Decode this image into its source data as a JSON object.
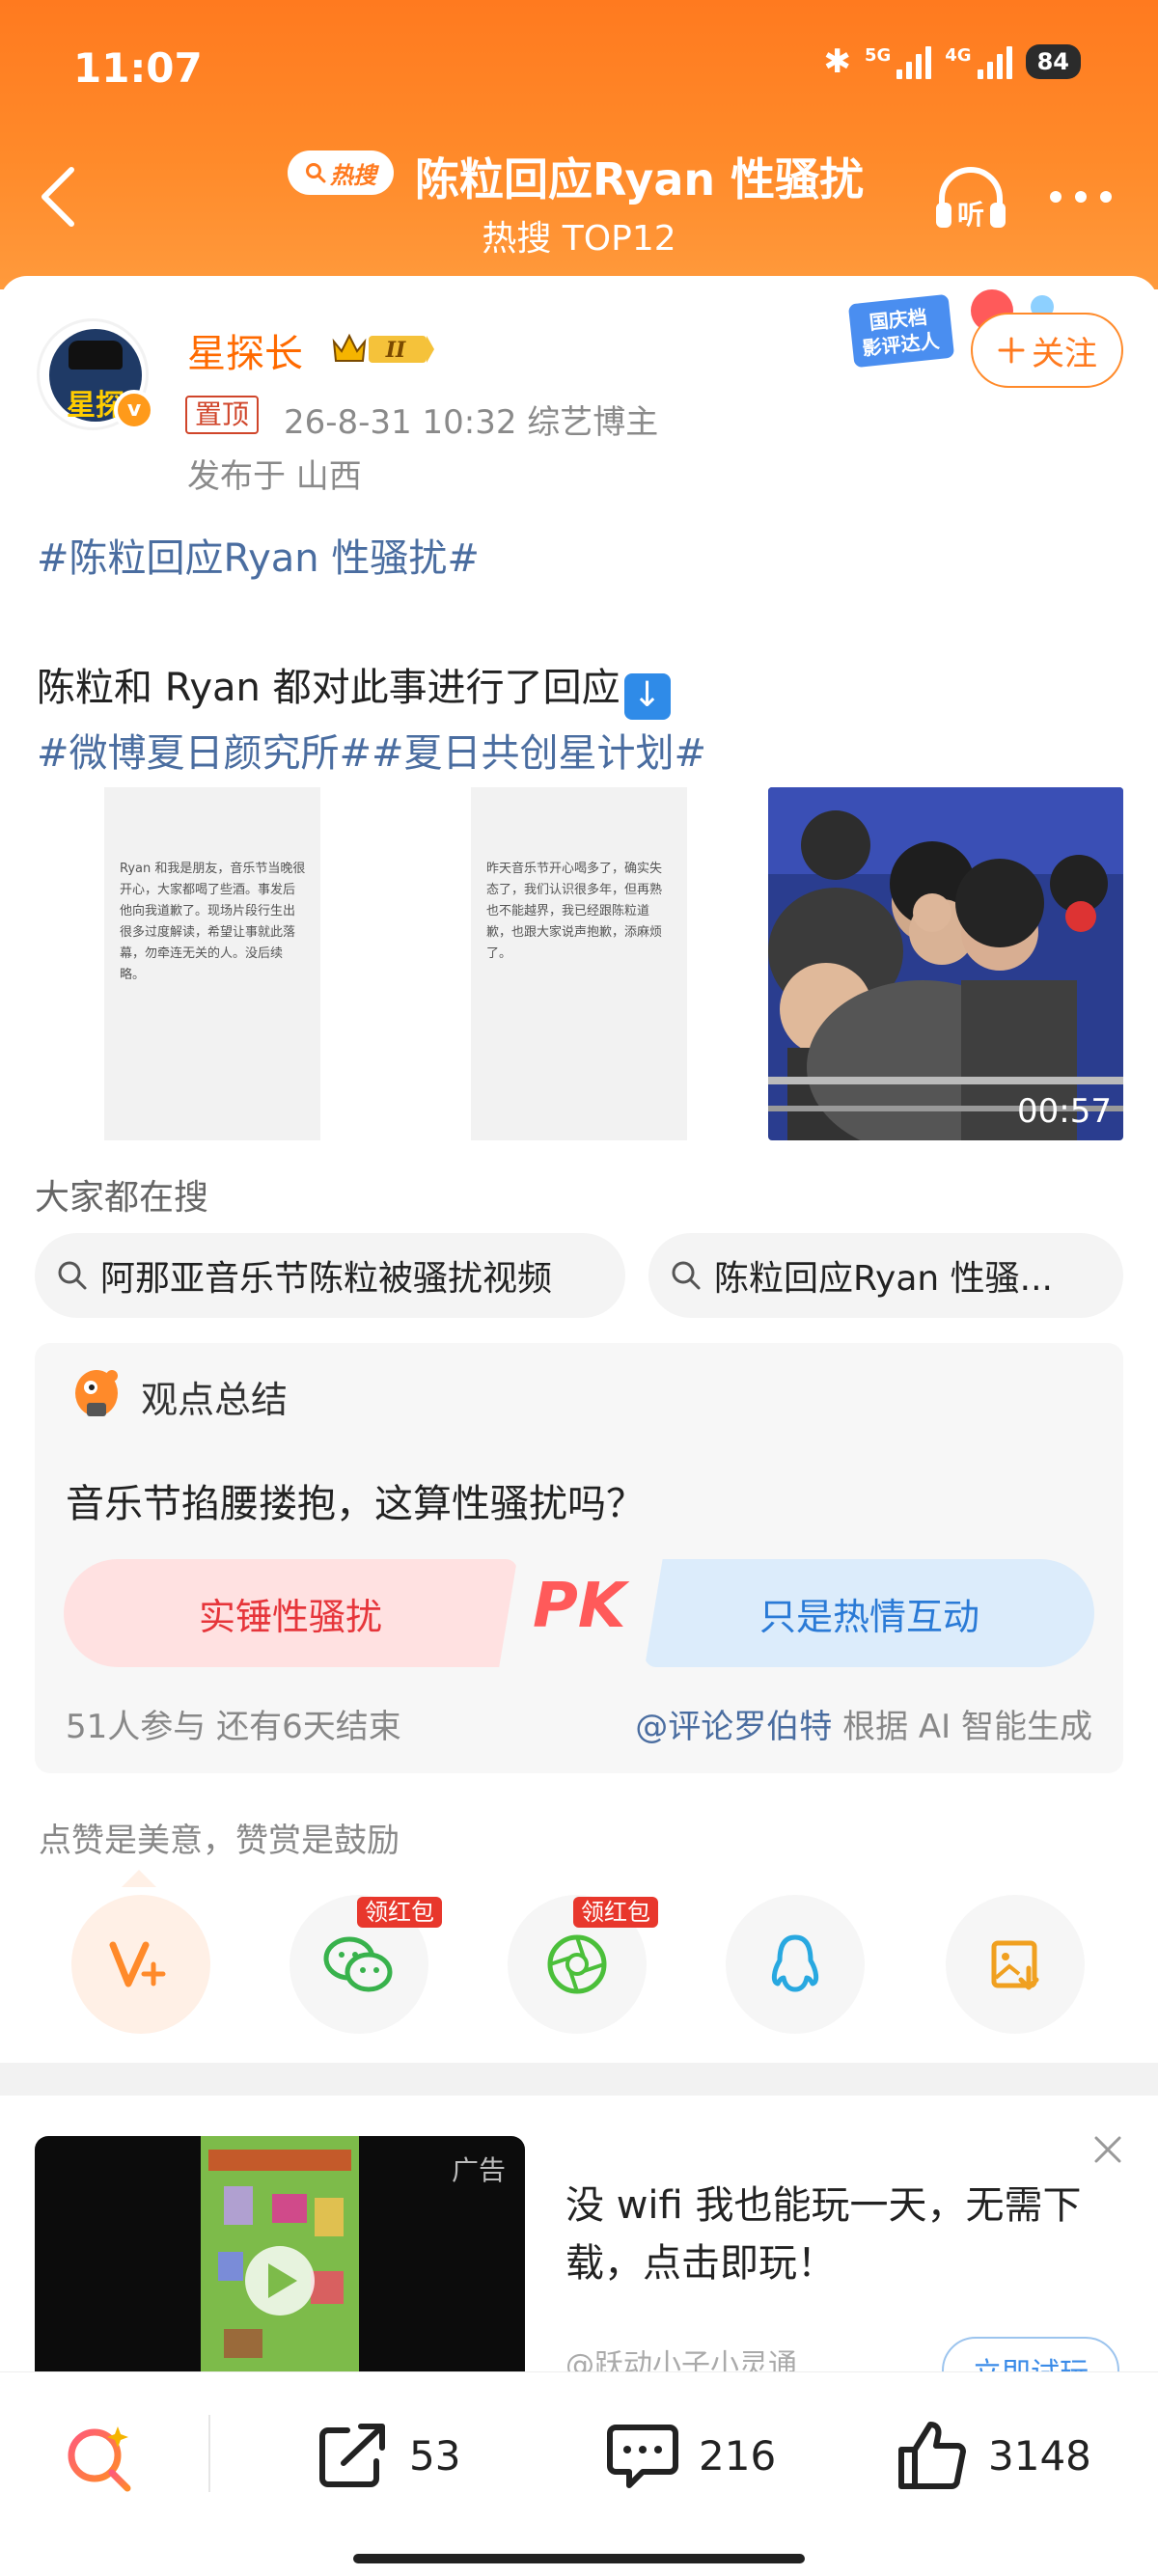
{
  "status_bar": {
    "time": "11:07",
    "network_1": "5G",
    "network_2": "4G",
    "battery": "84"
  },
  "header": {
    "hot_badge": "热搜",
    "title": "陈粒回应Ryan 性骚扰",
    "subtitle": "热搜 TOP12",
    "listen_label": "听"
  },
  "post": {
    "author": {
      "name": "星探长",
      "level": "II",
      "avatar_text": "星探",
      "verified_mark": "v"
    },
    "pinned_label": "置顶",
    "meta": "26-8-31 10:32   综艺博主",
    "location": "发布于 山西",
    "follow_label": "关注",
    "promo_badge": "国庆档影评达人",
    "topic_tag": "#陈粒回应Ryan 性骚扰#",
    "text_line1": "陈粒和 Ryan 都对此事进行了回应",
    "text_line2": "#微博夏日颜究所##夏日共创星计划#",
    "image1_text": "Ryan 和我是朋友，音乐节当晚很开心，大家都喝了些酒。事发后他向我道歉了。现场片段行生出很多过度解读，希望让事就此落幕，勿牵连无关的人。没后续略。",
    "image2_text": "昨天音乐节开心喝多了，确实失态了，我们认识很多年，但再熟也不能越界，我已经跟陈粒道歉，也跟大家说声抱歉，添麻烦了。",
    "video_duration": "00:57"
  },
  "related_search": {
    "title": "大家都在搜",
    "chips": [
      "阿那亚音乐节陈粒被骚扰视频",
      "陈粒回应Ryan 性骚..."
    ]
  },
  "summary": {
    "title": "观点总结",
    "question": "音乐节掐腰搂抱，这算性骚扰吗？",
    "option_left": "实锤性骚扰",
    "option_right": "只是热情互动",
    "pk_label": "PK",
    "participants": "51人参与   还有6天结束",
    "source_at": "@评论罗伯特",
    "source_suffix": " 根据 AI 智能生成"
  },
  "reward": {
    "text": "点赞是美意，赞赏是鼓励",
    "red_tag": "领红包"
  },
  "ad": {
    "label": "广告",
    "title": "没 wifi 我也能玩一天，无需下载，点击即玩！",
    "source": "@跃动小子小灵通",
    "button": "立即试玩"
  },
  "bottom_bar": {
    "reposts": "53",
    "comments": "216",
    "likes": "3148"
  },
  "colors": {
    "header_orange": "#ff7a1f",
    "link_blue": "#4a6da0",
    "pk_red": "#e6353a",
    "pk_blue": "#2a7ad6"
  }
}
